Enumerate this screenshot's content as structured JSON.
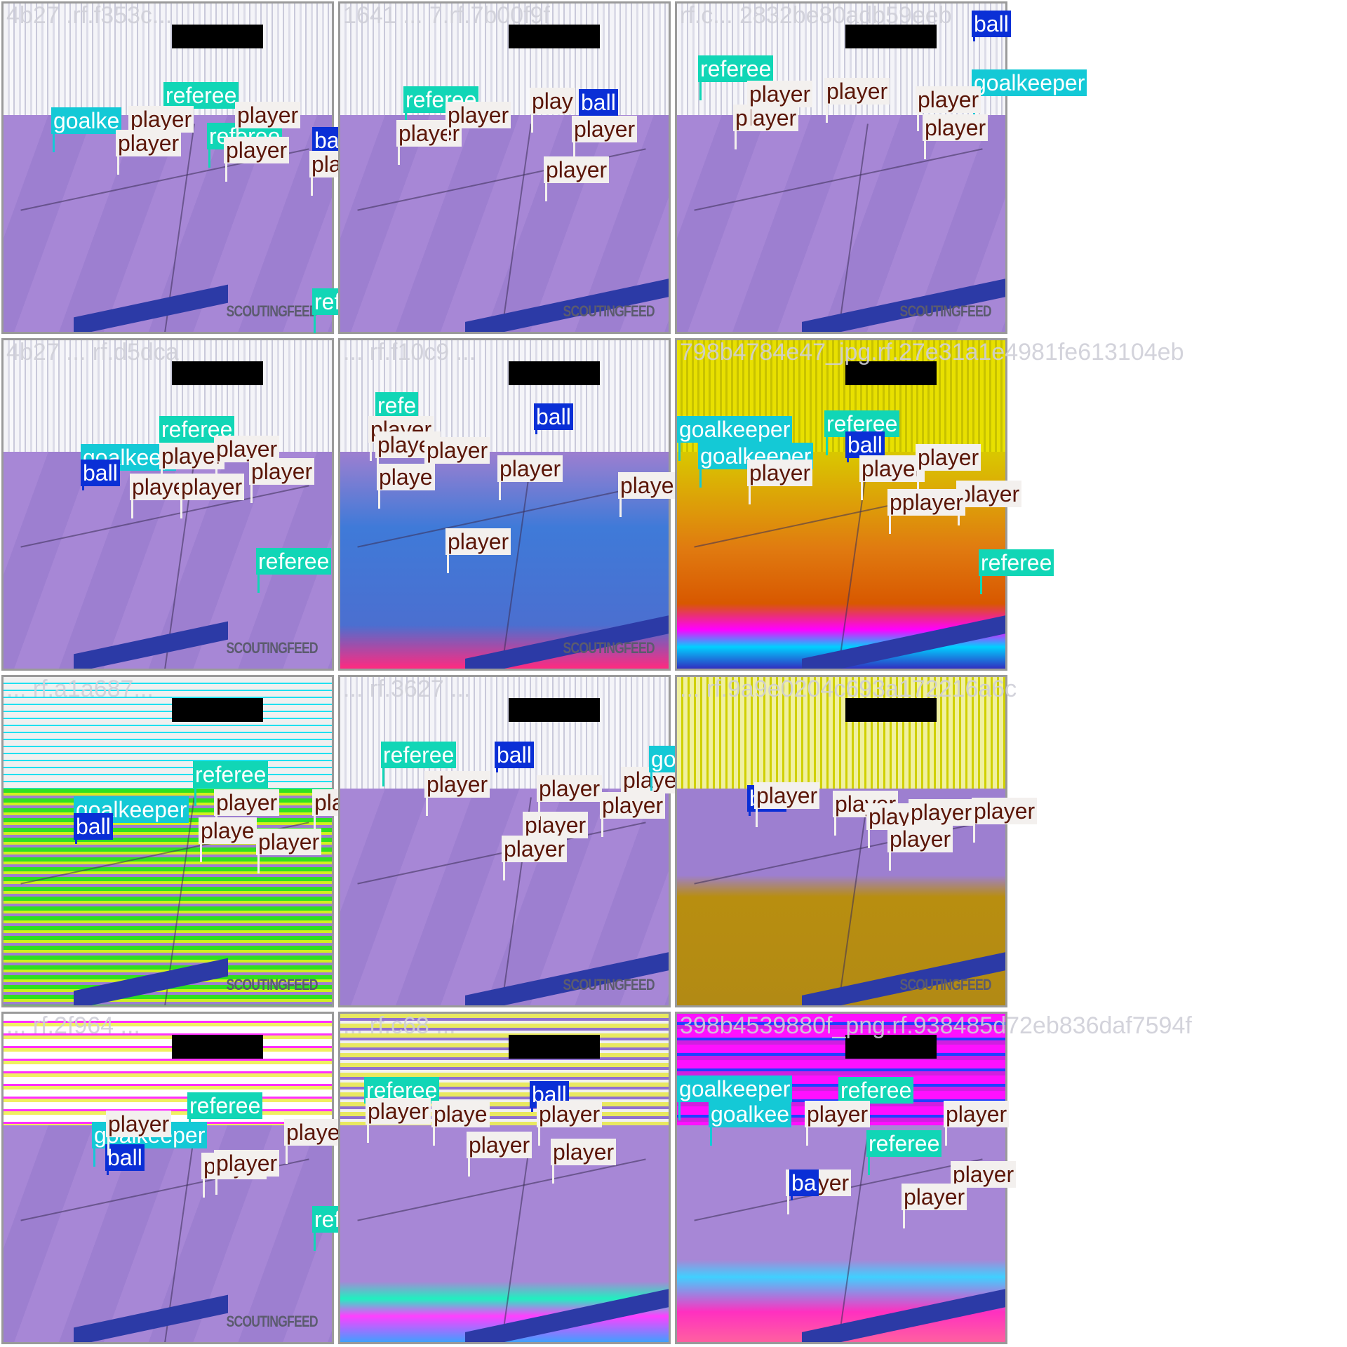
{
  "colors": {
    "player": "#f3f0ee",
    "player_text": "#5a1506",
    "referee": "#11d6b6",
    "goalkeeper": "#14c9d6",
    "ball": "#0a2fd6"
  },
  "tiles": [
    {
      "label": "4b27 .rf.f353c...",
      "watermark": "SCOUTINGFEED",
      "style": "plain",
      "detections": [
        {
          "cls": "referee",
          "label": "referee"
        },
        {
          "cls": "goalkeeper",
          "label": "goalke"
        },
        {
          "cls": "player",
          "label": "player"
        },
        {
          "cls": "referee",
          "label": "referee"
        },
        {
          "cls": "player",
          "label": "player"
        },
        {
          "cls": "ball",
          "label": "ball"
        },
        {
          "cls": "player",
          "label": "player"
        },
        {
          "cls": "player",
          "label": "player"
        },
        {
          "cls": "player",
          "label": "player"
        },
        {
          "cls": "referee",
          "label": "referee"
        }
      ]
    },
    {
      "label": "1641 ... 7.rf.7b00f9f",
      "watermark": "SCOUTINGFEED",
      "style": "plain",
      "detections": [
        {
          "cls": "referee",
          "label": "referee"
        },
        {
          "cls": "player",
          "label": "play"
        },
        {
          "cls": "ball",
          "label": "ball"
        },
        {
          "cls": "player",
          "label": "player"
        },
        {
          "cls": "player",
          "label": "player"
        },
        {
          "cls": "player",
          "label": "player"
        },
        {
          "cls": "player",
          "label": "player"
        }
      ]
    },
    {
      "label": "rf.c... 2832be80adb59eeb",
      "watermark": "SCOUTINGFEED",
      "style": "plain",
      "detections": [
        {
          "cls": "referee",
          "label": "referee"
        },
        {
          "cls": "goalkeeper",
          "label": "goalkeeper"
        },
        {
          "cls": "player",
          "label": "player"
        },
        {
          "cls": "player",
          "label": "player"
        },
        {
          "cls": "player",
          "label": "player"
        },
        {
          "cls": "player",
          "label": "player"
        },
        {
          "cls": "player",
          "label": "player"
        },
        {
          "cls": "ball",
          "label": "ball"
        }
      ]
    },
    {
      "label": "4b27 ... rf.d5dca",
      "watermark": "SCOUTINGFEED",
      "style": "plain",
      "detections": [
        {
          "cls": "referee",
          "label": "referee"
        },
        {
          "cls": "goalkeeper",
          "label": "goalkeep"
        },
        {
          "cls": "ball",
          "label": "ball"
        },
        {
          "cls": "player",
          "label": "player"
        },
        {
          "cls": "player",
          "label": "player"
        },
        {
          "cls": "player",
          "label": "player"
        },
        {
          "cls": "player",
          "label": "playe"
        },
        {
          "cls": "player",
          "label": "player"
        },
        {
          "cls": "referee",
          "label": "referee"
        }
      ]
    },
    {
      "label": "... rf.f10c9 ...",
      "watermark": "SCOUTINGFEED",
      "style": "blue",
      "detections": [
        {
          "cls": "referee",
          "label": "refe"
        },
        {
          "cls": "player",
          "label": "player"
        },
        {
          "cls": "ball",
          "label": "ball"
        },
        {
          "cls": "player",
          "label": "player"
        },
        {
          "cls": "player",
          "label": "player"
        },
        {
          "cls": "player",
          "label": "playe"
        },
        {
          "cls": "player",
          "label": "player"
        },
        {
          "cls": "player",
          "label": "player"
        },
        {
          "cls": "player",
          "label": "player"
        }
      ]
    },
    {
      "label": "798b4784e47_jpg.rf.27e31a1e4981fe613104eb",
      "watermark": "",
      "style": "yellow",
      "detections": [
        {
          "cls": "goalkeeper",
          "label": "goalkeeper"
        },
        {
          "cls": "referee",
          "label": "referee"
        },
        {
          "cls": "goalkeeper",
          "label": "goalkeeper"
        },
        {
          "cls": "ball",
          "label": "ball"
        },
        {
          "cls": "player",
          "label": "player"
        },
        {
          "cls": "player",
          "label": "player"
        },
        {
          "cls": "player",
          "label": "player"
        },
        {
          "cls": "player",
          "label": "player"
        },
        {
          "cls": "player",
          "label": "pplayer"
        },
        {
          "cls": "referee",
          "label": "referee"
        }
      ]
    },
    {
      "label": "... rf.a1a687...",
      "watermark": "SCOUTINGFEED",
      "style": "green",
      "detections": [
        {
          "cls": "referee",
          "label": "referee"
        },
        {
          "cls": "goalkeeper",
          "label": "goalkeeper"
        },
        {
          "cls": "ball",
          "label": "ball"
        },
        {
          "cls": "player",
          "label": "player"
        },
        {
          "cls": "player",
          "label": "player"
        },
        {
          "cls": "player",
          "label": "playe"
        },
        {
          "cls": "player",
          "label": "player"
        }
      ]
    },
    {
      "label": "... rf.3627 ...",
      "watermark": "SCOUTINGFEED",
      "style": "plain",
      "detections": [
        {
          "cls": "referee",
          "label": "referee"
        },
        {
          "cls": "ball",
          "label": "ball"
        },
        {
          "cls": "player",
          "label": "player"
        },
        {
          "cls": "player",
          "label": "player"
        },
        {
          "cls": "player",
          "label": "player"
        },
        {
          "cls": "player",
          "label": "player"
        },
        {
          "cls": "goalkeeper",
          "label": "goalkeeper"
        },
        {
          "cls": "player",
          "label": "player"
        },
        {
          "cls": "player",
          "label": "player"
        }
      ]
    },
    {
      "label": "... rf.9a9e0204c693a172216a6c",
      "watermark": "SCOUTINGFEED",
      "style": "olive",
      "detections": [
        {
          "cls": "ball",
          "label": "ball"
        },
        {
          "cls": "player",
          "label": "player"
        },
        {
          "cls": "player",
          "label": "player"
        },
        {
          "cls": "player",
          "label": "player"
        },
        {
          "cls": "player",
          "label": "player"
        },
        {
          "cls": "player",
          "label": "player"
        },
        {
          "cls": "player",
          "label": "player"
        }
      ]
    },
    {
      "label": "... rf.2f964 ...",
      "watermark": "SCOUTINGFEED",
      "style": "magenta",
      "detections": [
        {
          "cls": "referee",
          "label": "referee"
        },
        {
          "cls": "goalkeeper",
          "label": "goalkeeper"
        },
        {
          "cls": "ball",
          "label": "ball"
        },
        {
          "cls": "player",
          "label": "player"
        },
        {
          "cls": "player",
          "label": "player"
        },
        {
          "cls": "player",
          "label": "player"
        },
        {
          "cls": "player",
          "label": "player"
        },
        {
          "cls": "referee",
          "label": "referee"
        }
      ]
    },
    {
      "label": "... rf.c68 ...",
      "watermark": "",
      "style": "stripes",
      "detections": [
        {
          "cls": "referee",
          "label": "referee"
        },
        {
          "cls": "ball",
          "label": "ball"
        },
        {
          "cls": "player",
          "label": "player"
        },
        {
          "cls": "player",
          "label": "player"
        },
        {
          "cls": "player",
          "label": "playe"
        },
        {
          "cls": "player",
          "label": "player"
        },
        {
          "cls": "player",
          "label": "player"
        }
      ]
    },
    {
      "label": "398b4539880f_png.rf.938485d72eb836daf7594f",
      "watermark": "",
      "style": "magenta2",
      "detections": [
        {
          "cls": "goalkeeper",
          "label": "goalkeeper"
        },
        {
          "cls": "referee",
          "label": "referee"
        },
        {
          "cls": "goalkeeper",
          "label": "goalkee"
        },
        {
          "cls": "player",
          "label": "player"
        },
        {
          "cls": "player",
          "label": "player"
        },
        {
          "cls": "referee",
          "label": "referee"
        },
        {
          "cls": "player",
          "label": "player"
        },
        {
          "cls": "player",
          "label": "player"
        },
        {
          "cls": "player",
          "label": "player"
        },
        {
          "cls": "ball",
          "label": "ba"
        }
      ]
    }
  ]
}
